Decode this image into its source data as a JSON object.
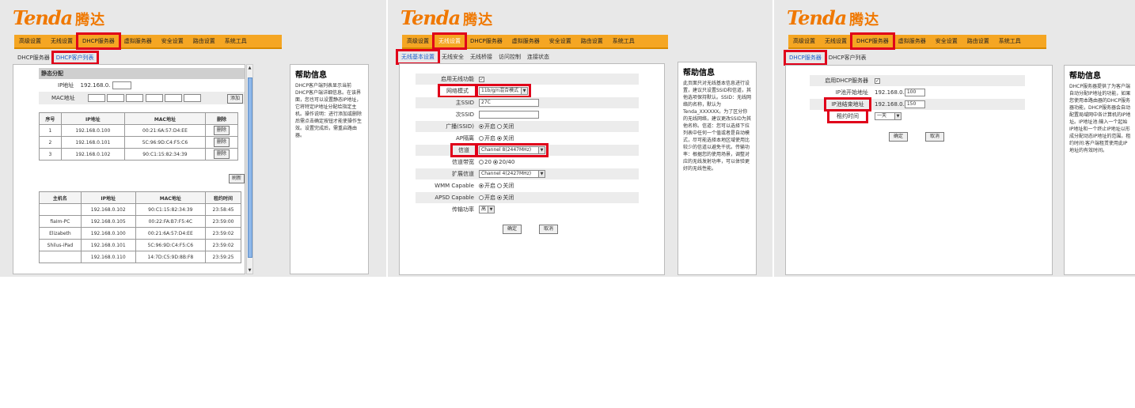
{
  "brand": {
    "logo": "Tenda",
    "logo_cn": "腾达"
  },
  "colors": {
    "accent": "#f5a623",
    "highlight": "#e0001a",
    "link": "#1f5fcc"
  },
  "p1": {
    "menu": [
      "高级设置",
      "无线设置",
      "DHCP服务器",
      "虚拟服务器",
      "安全设置",
      "路由设置",
      "系统工具"
    ],
    "submenu": [
      "DHCP服务器",
      "DHCP客户列表"
    ],
    "static_title": "静态分配",
    "ip_label": "IP地址",
    "ip_prefix": "192.168.0.",
    "mac_label": "MAC地址",
    "add_btn": "添加",
    "static_headers": [
      "序号",
      "IP地址",
      "MAC地址",
      "删除"
    ],
    "static_rows": [
      {
        "idx": "1",
        "ip": "192.168.0.100",
        "mac": "00:21:6A:57:D4:EE",
        "del": "删除"
      },
      {
        "idx": "2",
        "ip": "192.168.0.101",
        "mac": "5C:96:9D:C4:F5:C6",
        "del": "删除"
      },
      {
        "idx": "3",
        "ip": "192.168.0.102",
        "mac": "90:C1:15:82:34:39",
        "del": "删除"
      }
    ],
    "refresh_btn": "刷新",
    "client_headers": [
      "主机名",
      "IP地址",
      "MAC地址",
      "租约时间"
    ],
    "client_rows": [
      {
        "host": "",
        "ip": "192.168.0.102",
        "mac": "90:C1:15:82:34:39",
        "lease": "23:58:45"
      },
      {
        "host": "fiaIm-PC",
        "ip": "192.168.0.105",
        "mac": "00:22:FA:B7:F5:4C",
        "lease": "23:59:00"
      },
      {
        "host": "Elizabeth",
        "ip": "192.168.0.100",
        "mac": "00:21:6A:57:D4:EE",
        "lease": "23:59:02"
      },
      {
        "host": "Shilus-iPad",
        "ip": "192.168.0.101",
        "mac": "5C:96:9D:C4:F5:C6",
        "lease": "23:59:02"
      },
      {
        "host": "",
        "ip": "192.168.0.110",
        "mac": "14:7D:C5:9D:8B:F8",
        "lease": "23:59:25"
      }
    ],
    "help_title": "帮助信息",
    "help_text": "DHCP客户端列表显示当前DHCP客户端详细信息。在该界面，您也可以设置静态IP地址，它将特定IP地址分配给指定主机。操作说明：进行添加或删除后需点击确定按钮才能使操作生效。设置完成后，需重启路由器。"
  },
  "p2": {
    "menu": [
      "高级设置",
      "无线设置",
      "DHCP服务器",
      "虚拟服务器",
      "安全设置",
      "路由设置",
      "系统工具"
    ],
    "submenu": [
      "无线基本设置",
      "无线安全",
      "无线桥接",
      "访问控制",
      "连接状态"
    ],
    "enable_label": "启用无线功能",
    "mode_label": "网络模式",
    "mode_value": "11b/g/n混合模式",
    "ssid_label": "主SSID",
    "ssid_value": "27C",
    "ssid2_label": "次SSID",
    "broadcast_label": "广播(SSID)",
    "on": "开启",
    "off": "关闭",
    "ap_label": "AP隔离",
    "channel_label": "信道",
    "channel_value": "Channel 8(2447MHz)",
    "bw_label": "信道带宽",
    "bw_20": "20",
    "bw_40": "20/40",
    "ext_label": "扩展信道",
    "ext_value": "Channel 4(2427MHz)",
    "wmm_label": "WMM Capable",
    "apsd_label": "APSD Capable",
    "power_label": "传输功率",
    "power_value": "高",
    "ok_btn": "确定",
    "cancel_btn": "取消",
    "help_title": "帮助信息",
    "help_text": "此页面只对无线基本信息进行设置，建议只设置SSID和信道，其他选项保持默认。SSID：无线网络的名称，默认为Tenda_XXXXXX。为了区分你的无线网络，建议更改SSID为其他名称。信道：您可以选择下拉列表中任何一个值或者是自动模式，尽可能选择本地区域使用比较少的信道以避免干扰。传输功率：根据您的使用场景，调整对应的无线发射功率，可以体验更好的无线性能。"
  },
  "p3": {
    "menu": [
      "高级设置",
      "无线设置",
      "DHCP服务器",
      "虚拟服务器",
      "安全设置",
      "路由设置",
      "系统工具"
    ],
    "submenu": [
      "DHCP服务器",
      "DHCP客户列表"
    ],
    "enable_label": "启用DHCP服务器",
    "start_label": "IP池开始地址",
    "start_prefix": "192.168.0.",
    "start_value": "100",
    "end_label": "IP池结束地址",
    "end_prefix": "192.168.0.",
    "end_value": "150",
    "lease_label": "租约时间",
    "lease_value": "一天",
    "ok_btn": "确定",
    "cancel_btn": "取消",
    "help_title": "帮助信息",
    "help_text": "DHCP服务器提供了为客户端自动分配IP地址的功能，如果您使用本路由器的DHCP服务器功能，DHCP服务器会自动配置局域网中各计算机的IP地址。IP地址池:输入一个起始IP地址和一个终止IP地址以形成分配动态IP地址的范围。租约时间:客户端租赁使用此IP地址的有效时间。"
  }
}
